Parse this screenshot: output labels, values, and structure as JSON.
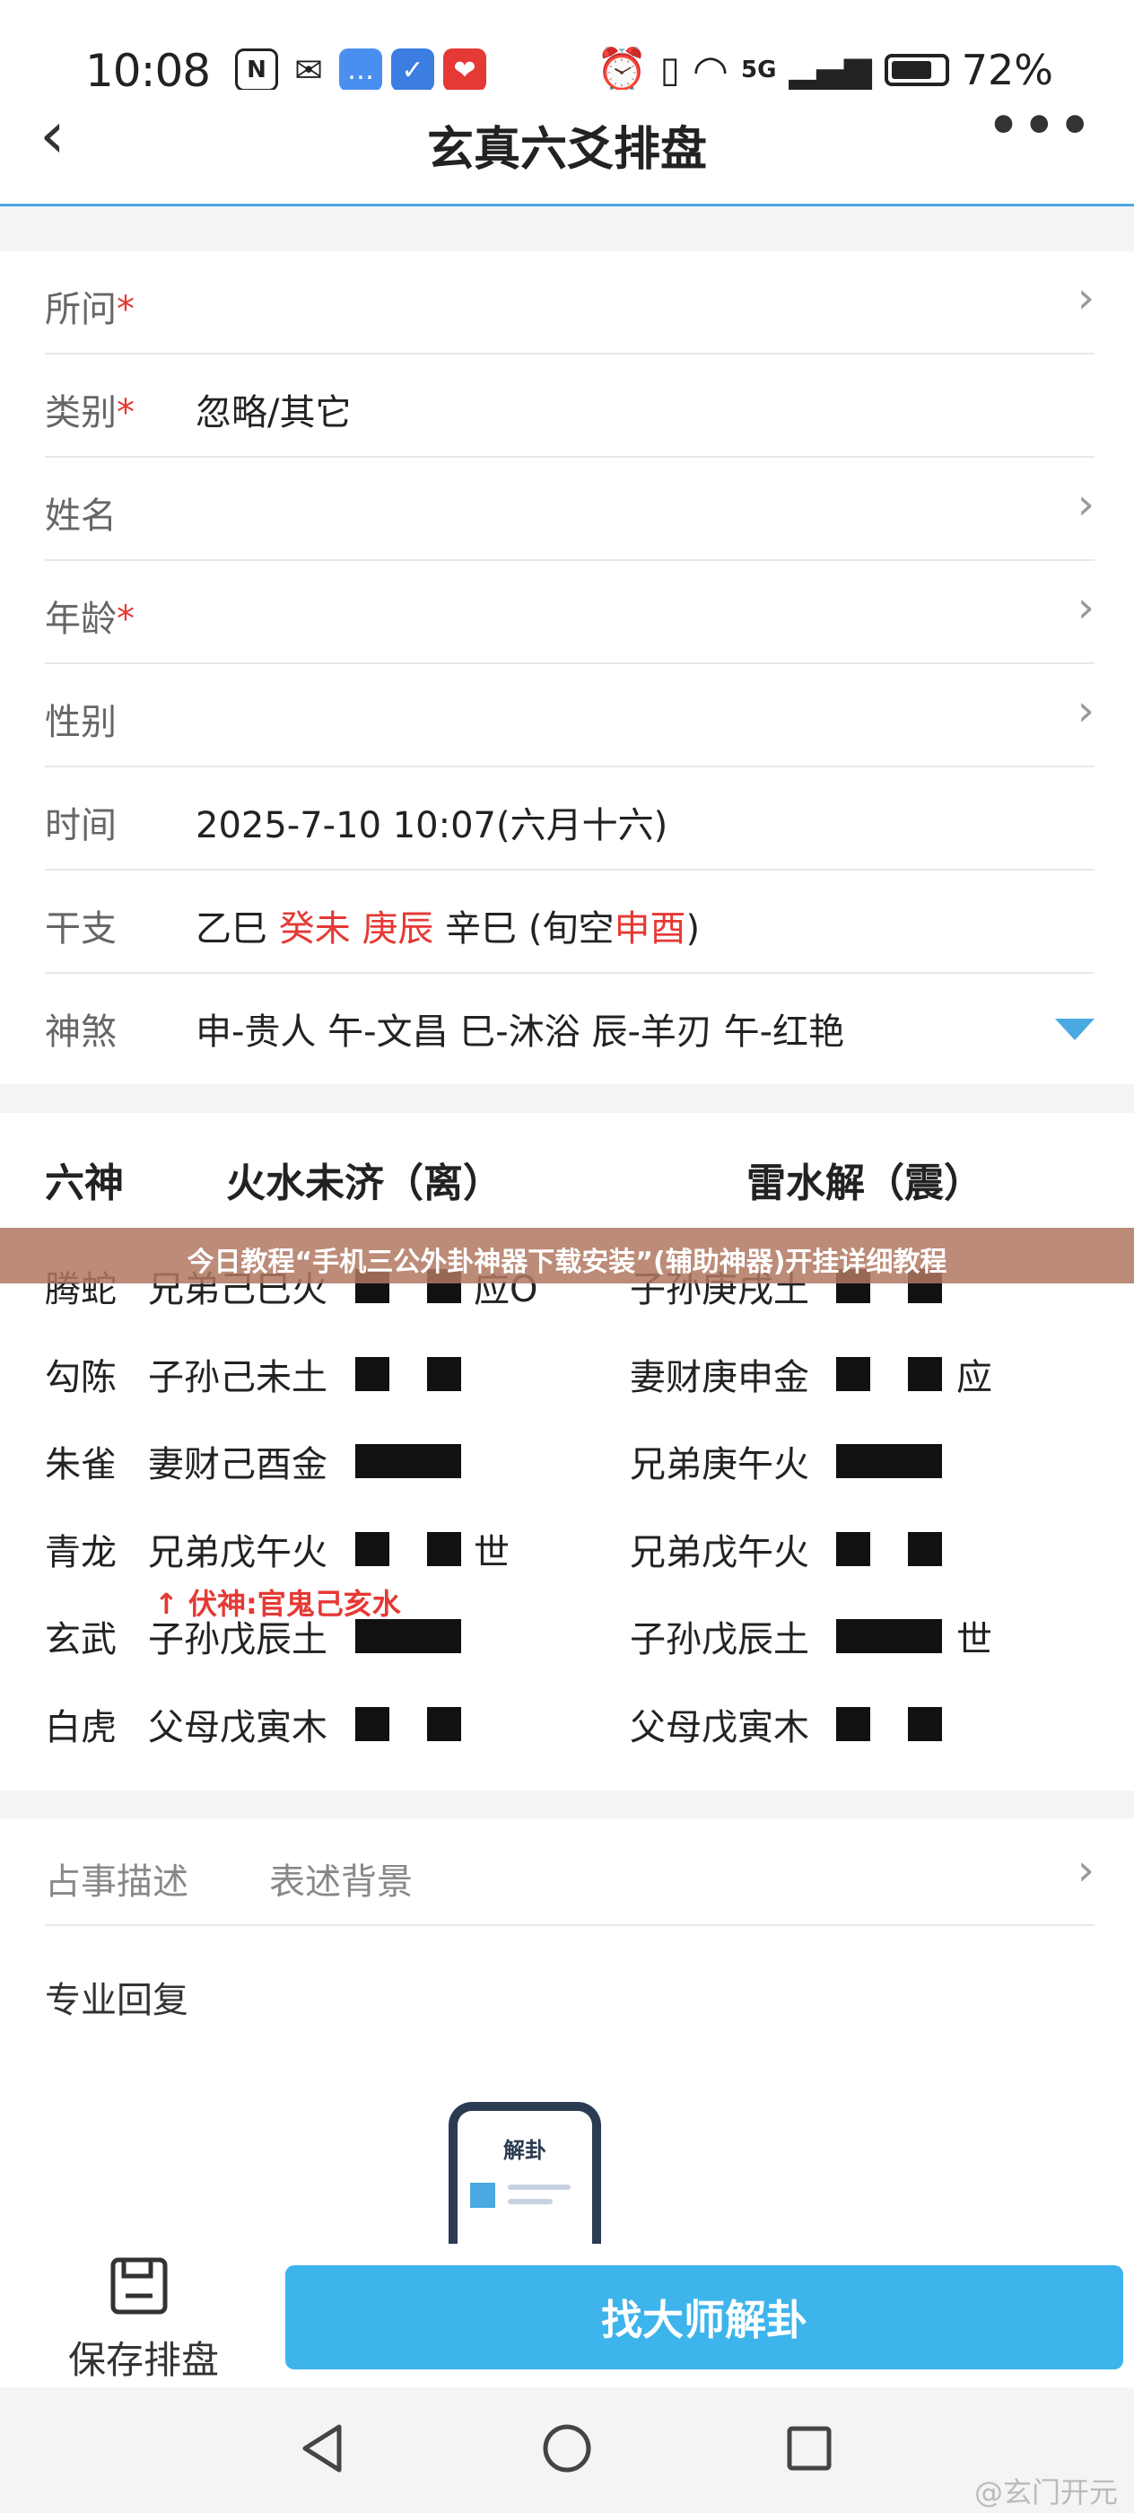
{
  "status_bar": {
    "time": "10:08",
    "battery": "72%",
    "network": "5G"
  },
  "header": {
    "title": "玄真六爻排盘"
  },
  "form": {
    "rows": [
      {
        "label": "所问",
        "required": "*",
        "value": ""
      },
      {
        "label": "类别",
        "required": "*",
        "value": "忽略/其它"
      },
      {
        "label": "姓名",
        "required": "",
        "value": ""
      },
      {
        "label": "年龄",
        "required": "*",
        "value": ""
      },
      {
        "label": "性别",
        "required": "",
        "value": ""
      },
      {
        "label": "时间",
        "required": "",
        "value": "2025-7-10 10:07(六月十六)"
      }
    ],
    "ganzhi": {
      "label": "干支",
      "p1": "乙巳",
      "p2": "癸未",
      "p3": "庚辰",
      "p4": "辛巳",
      "xk_open": "(旬空",
      "xk": "申酉",
      "xk_close": ")"
    },
    "shensha": {
      "label": "神煞",
      "value": "申-贵人 午-文昌 巳-沐浴 辰-羊刃 午-红艳"
    }
  },
  "gua": {
    "col_head": "六神",
    "left_title": "火水未济（离）",
    "right_title": "雷水解（震）",
    "lines": [
      {
        "shen": "腾蛇",
        "left": "兄弟己巳火",
        "left_yang": false,
        "left_mark": "",
        "right": "子孙庚戌土",
        "right_yang": false,
        "right_mark": ""
      },
      {
        "shen": "勾陈",
        "left": "子孙己未土",
        "left_yang": false,
        "left_mark": "",
        "right": "妻财庚申金",
        "right_yang": false,
        "right_mark": "应"
      },
      {
        "shen": "朱雀",
        "left": "妻财己酉金",
        "left_yang": true,
        "left_mark": "",
        "right": "兄弟庚午火",
        "right_yang": true,
        "right_mark": ""
      },
      {
        "shen": "青龙",
        "left": "兄弟戊午火",
        "left_yang": false,
        "left_mark": "世",
        "right": "兄弟戊午火",
        "right_yang": false,
        "right_mark": ""
      },
      {
        "shen": "玄武",
        "left": "子孙戊辰土",
        "left_yang": true,
        "left_mark": "",
        "right": "子孙戊辰土",
        "right_yang": true,
        "right_mark": "世"
      },
      {
        "shen": "白虎",
        "left": "父母戊寅木",
        "left_yang": false,
        "left_mark": "",
        "right": "父母戊寅木",
        "right_yang": false,
        "right_mark": ""
      }
    ],
    "first_line_left_mark": "应O",
    "fushen": "↑ 伏神:官鬼己亥水"
  },
  "banner": {
    "text": "今日教程“手机三公外卦神器下载安装”(辅助神器)开挂详细教程"
  },
  "description": {
    "label": "占事描述",
    "placeholder": "表述背景",
    "reply_label": "专业回复",
    "phone_text": "解卦"
  },
  "bottom": {
    "save_label": "保存排盘",
    "master_label": "找大师解卦"
  },
  "watermark": "@玄门开元",
  "colors": {
    "accent": "#3db4ec",
    "required": "#e53935",
    "banner": "#b07860"
  }
}
